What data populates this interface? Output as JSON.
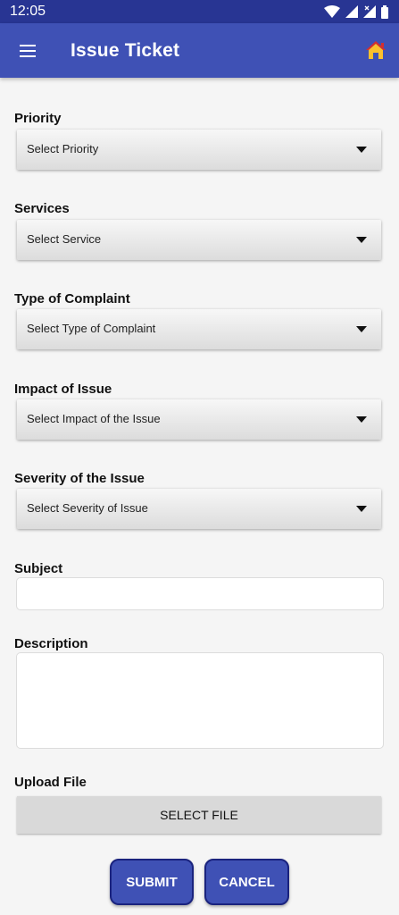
{
  "status_bar": {
    "time": "12:05"
  },
  "app_bar": {
    "title": "Issue Ticket",
    "menu_icon": "hamburger-menu-icon",
    "home_icon": "home-icon"
  },
  "colors": {
    "primary": "#3f51b5",
    "primary_dark": "#283593",
    "home_roof": "#d32f2f",
    "home_wall": "#fbc02d"
  },
  "form": {
    "priority": {
      "label": "Priority",
      "value": "Select Priority"
    },
    "services": {
      "label": "Services",
      "value": "Select Service"
    },
    "complaint_type": {
      "label": "Type of Complaint",
      "value": "Select Type of Complaint"
    },
    "impact": {
      "label": "Impact of Issue",
      "value": "Select Impact of the Issue"
    },
    "severity": {
      "label": "Severity of the Issue",
      "value": "Select Severity of Issue"
    },
    "subject": {
      "label": "Subject",
      "value": ""
    },
    "description": {
      "label": "Description",
      "value": ""
    },
    "upload": {
      "label": "Upload File",
      "button": "SELECT FILE"
    }
  },
  "actions": {
    "submit": "SUBMIT",
    "cancel": "CANCEL"
  }
}
